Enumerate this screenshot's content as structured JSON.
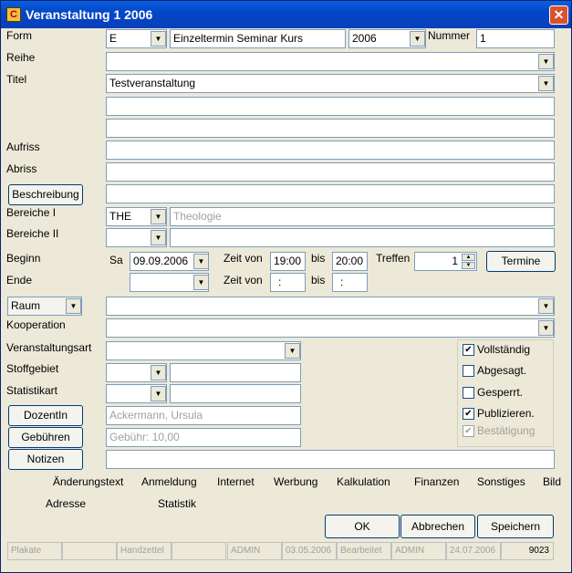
{
  "window": {
    "title": "Veranstaltung 1 2006"
  },
  "labels": {
    "form": "Form",
    "reihe": "Reihe",
    "titel": "Titel",
    "aufriss": "Aufriss",
    "abriss": "Abriss",
    "bereiche1": "Bereiche I",
    "bereiche2": "Bereiche II",
    "beginn": "Beginn",
    "ende": "Ende",
    "kooperation": "Kooperation",
    "veranstaltungsart": "Veranstaltungsart",
    "stoffgebiet": "Stoffgebiet",
    "statistikart": "Statistikart",
    "nummer": "Nummer",
    "zeitvon1": "Zeit von",
    "bis1": "bis",
    "zeitvon2": "Zeit von",
    "bis2": "bis",
    "treffen": "Treffen",
    "weekday": "Sa"
  },
  "fields": {
    "form_code": "E",
    "form_text": "Einzeltermin Seminar Kurs",
    "year": "2006",
    "nummer": "1",
    "reihe": "",
    "titel": "Testveranstaltung",
    "titel2": "",
    "titel3": "",
    "aufriss": "",
    "abriss": "",
    "beschreibung": "",
    "bereiche1_code": "THE",
    "bereiche1_text": "Theologie",
    "bereiche2_code": "",
    "bereiche2_text": "",
    "beginn_date": "09.09.2006",
    "zeit_von1": "19:00",
    "bis1": "20:00",
    "treffen": "1",
    "ende_date": "",
    "zeit_von2": ":",
    "bis2": ":",
    "raum": "",
    "kooperation": "",
    "veranstaltungsart": "",
    "stoffgebiet_code": "",
    "stoffgebiet_text": "",
    "statistikart_code": "",
    "statistikart_text": "",
    "dozent": "Ackermann, Ursula",
    "gebuehren": "Gebühr: 10,00",
    "notizen": ""
  },
  "buttons": {
    "beschreibung": "Beschreibung",
    "termine": "Termine",
    "raum": "Raum",
    "dozentin": "DozentIn",
    "gebuehren": "Gebühren",
    "notizen": "Notizen",
    "ok": "OK",
    "abbrechen": "Abbrechen",
    "speichern": "Speichern"
  },
  "checkboxes": [
    {
      "label": "Vollständig",
      "checked": true,
      "disabled": false
    },
    {
      "label": "Abgesagt.",
      "checked": false,
      "disabled": false
    },
    {
      "label": "Gesperrt.",
      "checked": false,
      "disabled": false
    },
    {
      "label": "Publizieren.",
      "checked": true,
      "disabled": false
    },
    {
      "label": "Bestätigung",
      "checked": true,
      "disabled": true
    }
  ],
  "links": {
    "row1": [
      "Änderungstext",
      "Anmeldung",
      "Internet",
      "Werbung",
      "Kalkulation",
      "Finanzen",
      "Sonstiges",
      "Bild"
    ],
    "row2": [
      "Adresse",
      "Statistik"
    ]
  },
  "statusbar": [
    "Plakate",
    "",
    "Handzettel",
    "",
    "ADMIN",
    "03.05.2006",
    "Bearbeitet",
    "ADMIN",
    "24.07.2006",
    "9023"
  ],
  "icons": {
    "dropdown": "▼",
    "check": "✔",
    "close": "✕",
    "spin_up": "▲",
    "spin_down": "▼"
  }
}
